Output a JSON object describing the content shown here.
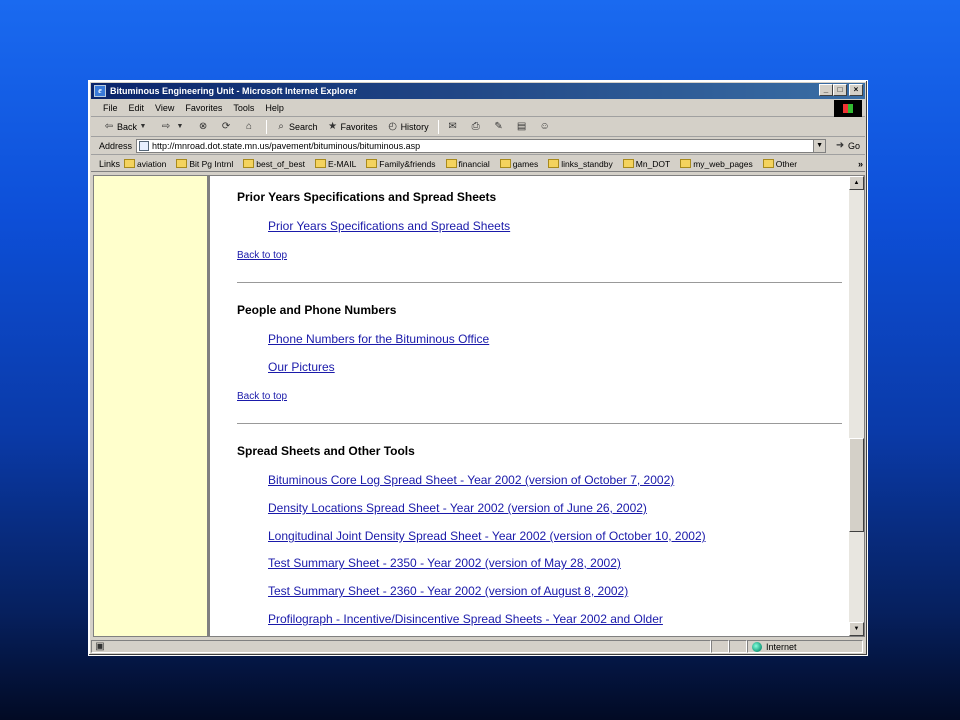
{
  "window": {
    "title": "Bituminous Engineering Unit - Microsoft Internet Explorer",
    "min_label": "_",
    "max_label": "□",
    "close_label": "×"
  },
  "menu": [
    "File",
    "Edit",
    "View",
    "Favorites",
    "Tools",
    "Help"
  ],
  "toolbar": {
    "back": "Back",
    "search": "Search",
    "favorites": "Favorites",
    "history": "History"
  },
  "address": {
    "label": "Address",
    "url": "http://mnroad.dot.state.mn.us/pavement/bituminous/bituminous.asp",
    "go": "Go"
  },
  "links": {
    "label": "Links",
    "items": [
      "aviation",
      "Bit Pg Intrnl",
      "best_of_best",
      "E-MAIL",
      "Family&friends",
      "financial",
      "games",
      "links_standby",
      "Mn_DOT",
      "my_web_pages",
      "Other"
    ]
  },
  "page": {
    "sections": [
      {
        "heading": "Prior Years Specifications and Spread Sheets",
        "links": [
          "Prior Years Specifications and Spread Sheets"
        ],
        "back": "Back to top"
      },
      {
        "heading": "People and Phone Numbers",
        "links": [
          "Phone Numbers for the Bituminous Office",
          "Our Pictures"
        ],
        "back": "Back to top"
      },
      {
        "heading": "Spread Sheets and Other Tools",
        "links": [
          "Bituminous Core Log Spread Sheet - Year 2002 (version of October 7, 2002)",
          "Density Locations Spread Sheet - Year 2002 (version of June 26, 2002)",
          "Longitudinal Joint Density Spread Sheet - Year 2002 (version of October 10, 2002)",
          "Test Summary Sheet - 2350 - Year 2002 (version of May 28, 2002)",
          "Test Summary Sheet - 2360 - Year 2002 (version of August 8, 2002)",
          "Profilograph - Incentive/Disincentive Spread Sheets - Year 2002 and Older"
        ]
      }
    ]
  },
  "status": {
    "zone": "Internet"
  }
}
